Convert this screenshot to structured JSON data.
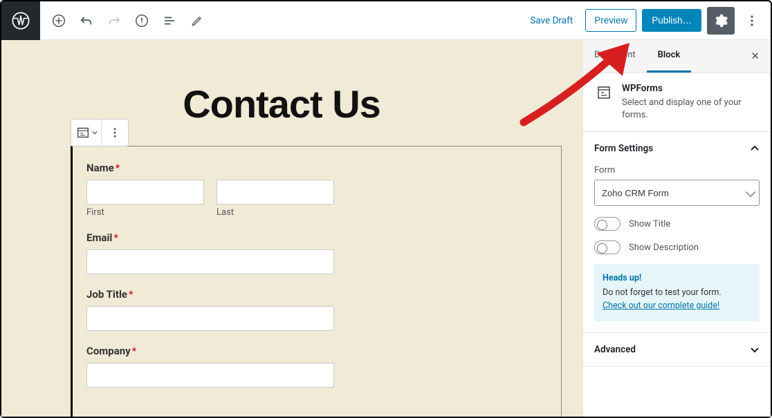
{
  "toolbar": {
    "save_draft": "Save Draft",
    "preview": "Preview",
    "publish": "Publish…"
  },
  "canvas": {
    "page_title": "Contact Us",
    "form": {
      "name_label": "Name",
      "name_first_sub": "First",
      "name_last_sub": "Last",
      "email_label": "Email",
      "job_title_label": "Job Title",
      "company_label": "Company"
    }
  },
  "sidebar": {
    "tabs": {
      "document": "Document",
      "block": "Block"
    },
    "block_info": {
      "title": "WPForms",
      "description": "Select and display one of your forms."
    },
    "panels": {
      "form_settings": {
        "title": "Form Settings",
        "form_label": "Form",
        "form_value": "Zoho CRM Form",
        "show_title": "Show Title",
        "show_description": "Show Description",
        "notice_title": "Heads up!",
        "notice_text": "Do not forget to test your form.",
        "notice_link": "Check out our complete guide!"
      },
      "advanced": {
        "title": "Advanced"
      }
    }
  }
}
